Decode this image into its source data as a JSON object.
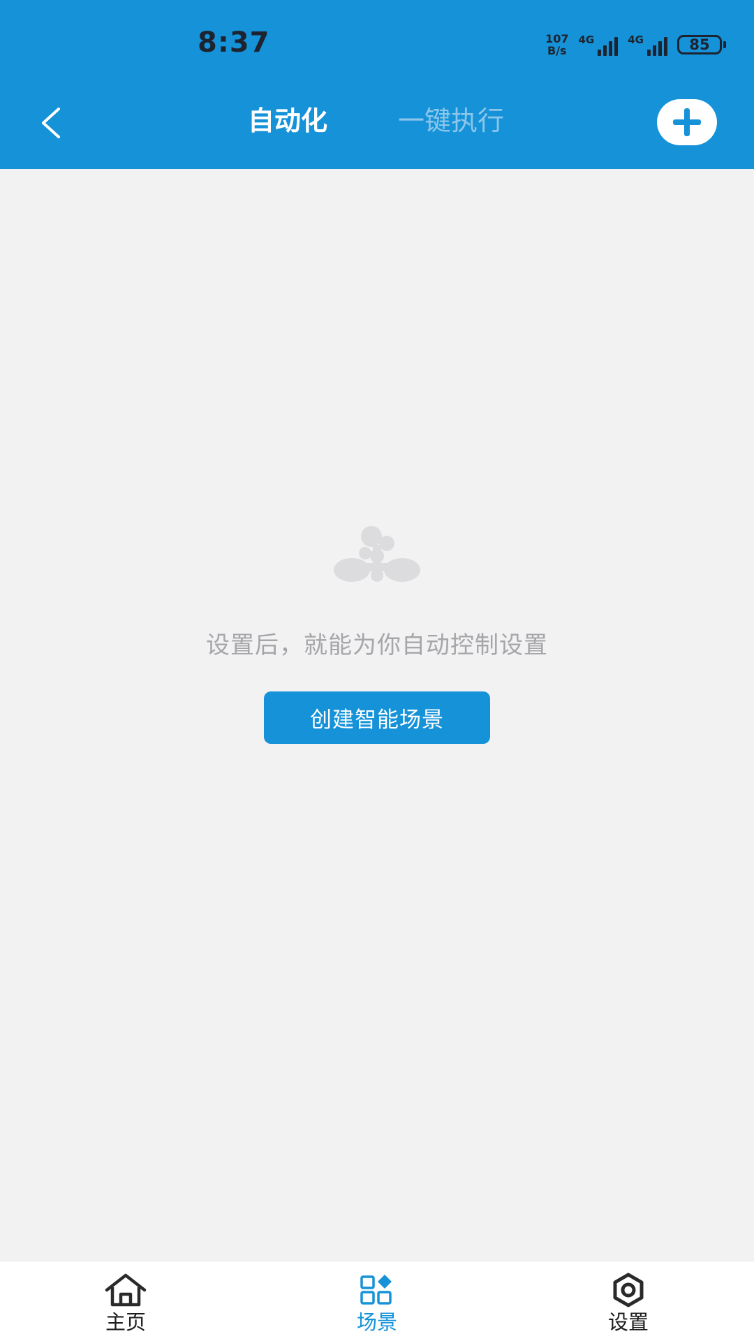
{
  "status_bar": {
    "time": "8:37",
    "net_speed_value": "107",
    "net_speed_unit": "B/s",
    "sim1_network": "4G",
    "sim2_network": "4G",
    "battery_percent": "85"
  },
  "header": {
    "back_icon": "chevron-left-icon",
    "tabs": [
      {
        "label": "自动化",
        "active": true
      },
      {
        "label": "一键执行",
        "active": false
      }
    ],
    "add_icon": "plus-icon"
  },
  "empty_state": {
    "icon": "scene-molecule-icon",
    "message": "设置后，就能为你自动控制设置",
    "button_label": "创建智能场景"
  },
  "bottom_nav": {
    "items": [
      {
        "label": "主页",
        "icon": "home-icon",
        "active": false
      },
      {
        "label": "场景",
        "icon": "scene-grid-icon",
        "active": true
      },
      {
        "label": "设置",
        "icon": "gear-icon",
        "active": false
      }
    ]
  },
  "colors": {
    "primary": "#1592d8",
    "background": "#f2f2f3",
    "text_muted": "#a6a6aa",
    "nav_inactive": "#1d1d1f"
  }
}
